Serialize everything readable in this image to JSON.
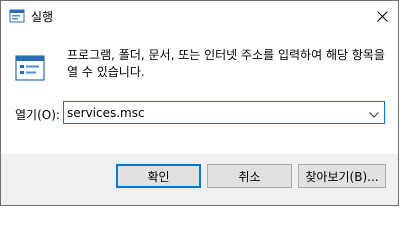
{
  "window": {
    "title": "실행",
    "icons": {
      "app": "run-app-icon",
      "close": "close-icon",
      "run": "run-window-icon",
      "dropdown": "chevron-down-icon"
    }
  },
  "description": "프로그램, 폴더, 문서, 또는 인터넷 주소를 입력하여 해당 항목을 열 수 있습니다.",
  "open_field": {
    "label": "열기(O):",
    "value": "services.msc"
  },
  "buttons": {
    "ok": "확인",
    "cancel": "취소",
    "browse": "찾아보기(B)..."
  },
  "colors": {
    "accent": "#0078d7",
    "footer_bg": "#f0f0f0",
    "button_bg": "#e1e1e1"
  }
}
